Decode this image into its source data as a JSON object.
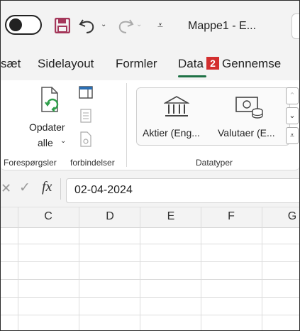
{
  "title_bar": {
    "document_title": "Mappe1  -  E...",
    "autosave_state": "off"
  },
  "tabs": [
    {
      "label": "sæt"
    },
    {
      "label": "Sidelayout"
    },
    {
      "label": "Formler"
    },
    {
      "label": "Data",
      "active": true
    },
    {
      "label": "Gennemse"
    }
  ],
  "annotation_badge": "2",
  "ribbon": {
    "refresh_all_label_line1": "Opdater",
    "refresh_all_label_line2": "alle",
    "group_queries_label": "Forespørgsler",
    "group_connections_label": "forbindelser",
    "stocks_label": "Aktier (Eng...",
    "currencies_label": "Valutaer (E...",
    "group_datatypes_label": "Datatyper"
  },
  "formula_bar": {
    "fx_label": "fx",
    "value": "02-04-2024"
  },
  "grid": {
    "columns": [
      "C",
      "D",
      "E",
      "F",
      "G"
    ]
  },
  "colors": {
    "accent_green": "#1e7145",
    "save_purple": "#a4375a",
    "badge_red": "#d32f2f",
    "refresh_green": "#2e9e4a"
  }
}
